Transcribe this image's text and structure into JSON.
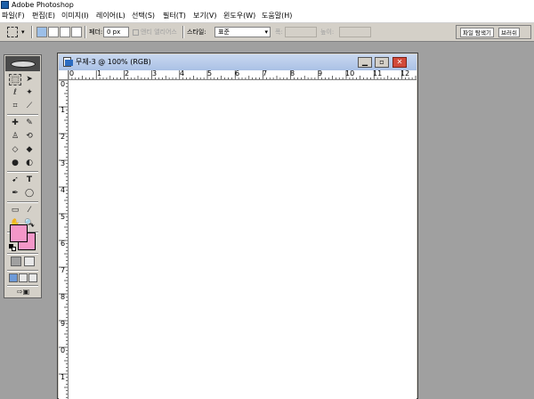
{
  "app": {
    "title": "Adobe Photoshop"
  },
  "menu": [
    "파일(F)",
    "편집(E)",
    "이미지(I)",
    "레이어(L)",
    "선택(S)",
    "필터(T)",
    "보기(V)",
    "윈도우(W)",
    "도움말(H)"
  ],
  "options": {
    "feather_label": "페더:",
    "feather_value": "0 px",
    "antialias_label": "앤티 앨리어스",
    "style_label": "스타일:",
    "style_value": "표준",
    "width_label": "폭:",
    "height_label": "높이:"
  },
  "palette_well": {
    "tabs": [
      "파일 탐색기",
      "브러쉬"
    ]
  },
  "toolbox": {
    "foreground_color": "#f497c8",
    "background_color": "#f497c8",
    "tools": [
      "rectangular-marquee-icon",
      "move-icon",
      "lasso-icon",
      "magic-wand-icon",
      "crop-icon",
      "slice-icon",
      "healing-brush-icon",
      "brush-icon",
      "clone-stamp-icon",
      "history-brush-icon",
      "eraser-icon",
      "paint-bucket-icon",
      "blur-icon",
      "dodge-icon",
      "path-selection-icon",
      "type-icon",
      "pen-icon",
      "shape-icon",
      "notes-icon",
      "eyedropper-icon",
      "hand-icon",
      "zoom-icon"
    ]
  },
  "document": {
    "title": "무제-3 @ 100% (RGB)",
    "background_color": "#ffffff",
    "ruler_h_labels": [
      "0",
      "1",
      "2",
      "3",
      "4",
      "5",
      "6",
      "7",
      "8",
      "9",
      "10",
      "11",
      "12"
    ],
    "ruler_v_labels": [
      "0",
      "1",
      "2",
      "3",
      "4",
      "5",
      "6",
      "7",
      "8",
      "9",
      "0",
      "1"
    ]
  },
  "colors": {
    "workspace": "#a0a0a0",
    "chrome": "#d4d0c8",
    "doc_titlebar": "#aac1e5",
    "close_button": "#d24a3a"
  }
}
